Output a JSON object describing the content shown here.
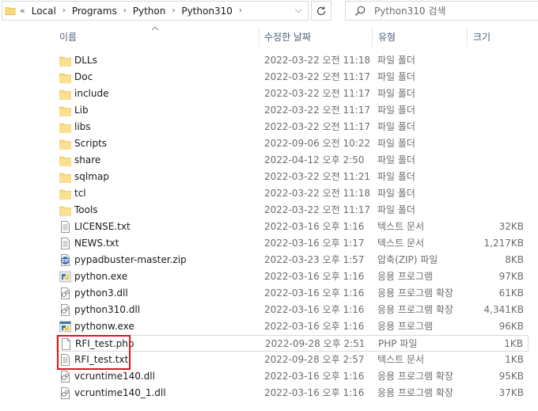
{
  "address": {
    "overflow": "«",
    "crumbs": [
      "Local",
      "Programs",
      "Python",
      "Python310"
    ]
  },
  "search": {
    "placeholder": "Python310 검색"
  },
  "columns": {
    "name": "이름",
    "date": "수정한 날짜",
    "type": "유형",
    "size": "크기"
  },
  "files": [
    {
      "name": "DLLs",
      "date": "2022-03-22 오전 11:18",
      "type": "파일 폴더",
      "size": "",
      "icon": "folder"
    },
    {
      "name": "Doc",
      "date": "2022-03-22 오전 11:17",
      "type": "파일 폴더",
      "size": "",
      "icon": "folder"
    },
    {
      "name": "include",
      "date": "2022-03-22 오전 11:17",
      "type": "파일 폴더",
      "size": "",
      "icon": "folder"
    },
    {
      "name": "Lib",
      "date": "2022-03-22 오전 11:17",
      "type": "파일 폴더",
      "size": "",
      "icon": "folder"
    },
    {
      "name": "libs",
      "date": "2022-03-22 오전 11:17",
      "type": "파일 폴더",
      "size": "",
      "icon": "folder"
    },
    {
      "name": "Scripts",
      "date": "2022-09-06 오전 10:22",
      "type": "파일 폴더",
      "size": "",
      "icon": "folder"
    },
    {
      "name": "share",
      "date": "2022-04-12 오후 2:50",
      "type": "파일 폴더",
      "size": "",
      "icon": "folder"
    },
    {
      "name": "sqlmap",
      "date": "2022-03-22 오전 11:21",
      "type": "파일 폴더",
      "size": "",
      "icon": "folder"
    },
    {
      "name": "tcl",
      "date": "2022-03-22 오전 11:18",
      "type": "파일 폴더",
      "size": "",
      "icon": "folder"
    },
    {
      "name": "Tools",
      "date": "2022-03-22 오전 11:17",
      "type": "파일 폴더",
      "size": "",
      "icon": "folder"
    },
    {
      "name": "LICENSE.txt",
      "date": "2022-03-16 오후 1:16",
      "type": "텍스트 문서",
      "size": "32KB",
      "icon": "text"
    },
    {
      "name": "NEWS.txt",
      "date": "2022-03-16 오후 1:17",
      "type": "텍스트 문서",
      "size": "1,217KB",
      "icon": "text"
    },
    {
      "name": "pypadbuster-master.zip",
      "date": "2022-03-23 오후 1:57",
      "type": "압축(ZIP) 파일",
      "size": "8KB",
      "icon": "zip"
    },
    {
      "name": "python.exe",
      "date": "2022-03-16 오후 1:16",
      "type": "응용 프로그램",
      "size": "97KB",
      "icon": "python-exe"
    },
    {
      "name": "python3.dll",
      "date": "2022-03-16 오후 1:16",
      "type": "응용 프로그램 확장",
      "size": "61KB",
      "icon": "dll"
    },
    {
      "name": "python310.dll",
      "date": "2022-03-16 오후 1:16",
      "type": "응용 프로그램 확장",
      "size": "4,341KB",
      "icon": "dll"
    },
    {
      "name": "pythonw.exe",
      "date": "2022-03-16 오후 1:16",
      "type": "응용 프로그램",
      "size": "96KB",
      "icon": "pythonw-exe"
    },
    {
      "name": "RFI_test.php",
      "date": "2022-09-28 오후 2:51",
      "type": "PHP 파일",
      "size": "1KB",
      "icon": "blank",
      "highlight": true
    },
    {
      "name": "RFI_test.txt",
      "date": "2022-09-28 오후 2:57",
      "type": "텍스트 문서",
      "size": "1KB",
      "icon": "text"
    },
    {
      "name": "vcruntime140.dll",
      "date": "2022-03-16 오후 1:16",
      "type": "응용 프로그램 확장",
      "size": "95KB",
      "icon": "dll"
    },
    {
      "name": "vcruntime140_1.dll",
      "date": "2022-03-16 오후 1:16",
      "type": "응용 프로그램 확장",
      "size": "37KB",
      "icon": "dll"
    }
  ],
  "colors": {
    "header_text": "#4c607a",
    "folder": "#f8d775",
    "annotation": "#e0141e"
  }
}
